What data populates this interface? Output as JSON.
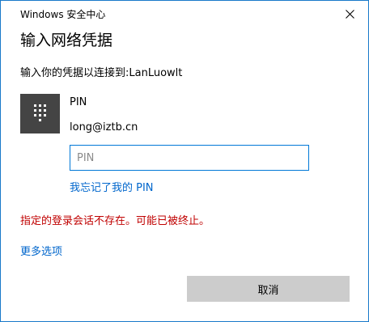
{
  "window": {
    "title": "Windows 安全中心",
    "close_icon": "close-icon"
  },
  "dialog": {
    "heading": "输入网络凭据",
    "prompt": "输入你的凭据以连接到:LanLuowlt"
  },
  "credential": {
    "tile_icon": "pin-keypad-icon",
    "type_label": "PIN",
    "username": "long@iztb.cn"
  },
  "pin_input": {
    "placeholder": "PIN",
    "value": ""
  },
  "links": {
    "forgot_pin": "我忘记了我的 PIN",
    "more_options": "更多选项"
  },
  "error": {
    "message": "指定的登录会话不存在。可能已被终止。"
  },
  "buttons": {
    "cancel": "取消"
  },
  "colors": {
    "window_border": "#1979ca",
    "tile_background": "#444444",
    "input_border": "#0078d7",
    "link": "#0066cc",
    "error": "#c00000",
    "button_background": "#cccccc"
  }
}
